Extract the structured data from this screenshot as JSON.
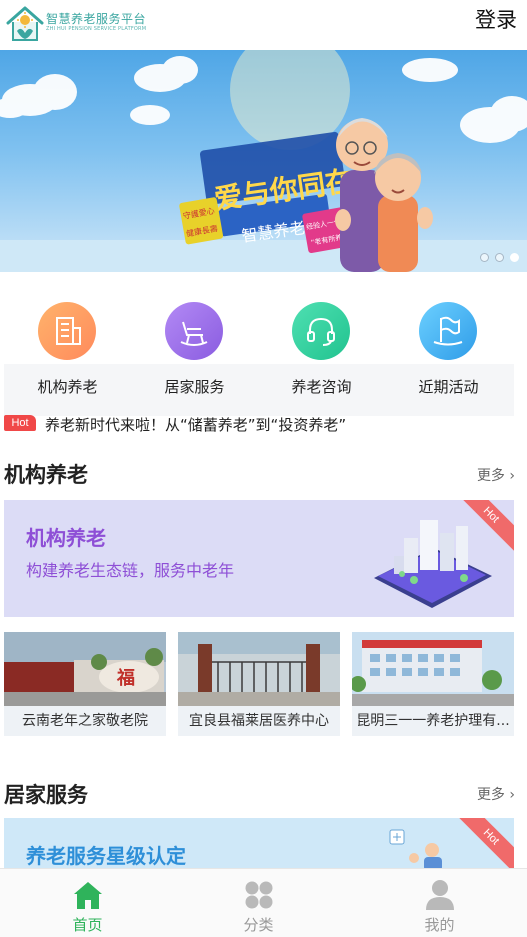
{
  "header": {
    "brand_name": "智慧养老服务平台",
    "brand_subtitle": "ZHI HUI PENSION SERVICE PLATFORM",
    "login_label": "登录",
    "logo_icon": "house-heart-icon"
  },
  "banner": {
    "headline": "爱与你同在",
    "badge_left_1": "守護愛心",
    "badge_left_2": "健康長壽",
    "badge_center": "智慧养老",
    "badge_right_1": "经验人一个",
    "badge_right_2": "“老有所养”",
    "slide_count": 3,
    "active_slide": 3
  },
  "nav": {
    "items": [
      {
        "label": "机构养老",
        "icon": "building-icon",
        "color_from": "#ffb36b",
        "color_to": "#ff8a5c"
      },
      {
        "label": "居家服务",
        "icon": "rocking-chair-icon",
        "color_from": "#b38af5",
        "color_to": "#8a5ce0"
      },
      {
        "label": "养老咨询",
        "icon": "headset-icon",
        "color_from": "#4fe0b2",
        "color_to": "#21c38f"
      },
      {
        "label": "近期活动",
        "icon": "flag-icon",
        "color_from": "#6cd0ff",
        "color_to": "#2f9ce8"
      }
    ]
  },
  "ticker": {
    "tag": "Hot",
    "text": "养老新时代来啦！从“储蓄养老”到“投资养老”"
  },
  "institution": {
    "section_title": "机构养老",
    "more_label": "更多",
    "promo_title": "机构养老",
    "promo_subtitle": "构建养老生态链，服务中老年",
    "promo_badge": "Hot",
    "facilities": [
      {
        "name": "云南老年之家敬老院",
        "image_text": "福"
      },
      {
        "name": "宜良县福莱居医养中心"
      },
      {
        "name": "昆明三一一养老护理有..."
      }
    ]
  },
  "home_service": {
    "section_title": "居家服务",
    "more_label": "更多",
    "promo_title": "养老服务星级认定",
    "promo_badge": "Hot"
  },
  "tabbar": {
    "tabs": [
      {
        "label": "首页",
        "icon": "home-icon",
        "active": true
      },
      {
        "label": "分类",
        "icon": "grid-icon",
        "active": false
      },
      {
        "label": "我的",
        "icon": "user-icon",
        "active": false
      }
    ]
  },
  "colors": {
    "accent_green": "#2fb35b",
    "promo_purple": "#8e4fd6",
    "hot_red": "#f04848"
  }
}
